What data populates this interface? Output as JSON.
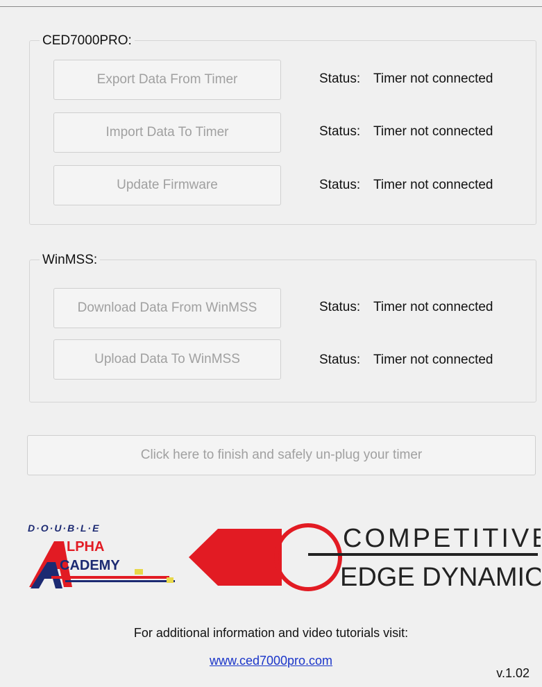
{
  "ced_group": {
    "title": "CED7000PRO:",
    "rows": [
      {
        "button": "Export Data From Timer",
        "status_label": "Status:",
        "status": "Timer not connected"
      },
      {
        "button": "Import Data To Timer",
        "status_label": "Status:",
        "status": "Timer not connected"
      },
      {
        "button": "Update Firmware",
        "status_label": "Status:",
        "status": "Timer not connected"
      }
    ]
  },
  "winmss_group": {
    "title": "WinMSS:",
    "rows": [
      {
        "button": "Download Data From WinMSS",
        "status_label": "Status:",
        "status": "Timer not connected"
      },
      {
        "button": "Upload Data To WinMSS",
        "status_label": "Status:",
        "status": "Timer not connected"
      }
    ]
  },
  "finish_button": "Click here to finish and safely un-plug your timer",
  "logos": {
    "daa": {
      "line1": "D·O·U·B·L·E",
      "line2": "LPHA",
      "line3": "CADEMY"
    },
    "ced": {
      "line1": "COMPETITIVE",
      "line2": "EDGE DYNAMICS"
    }
  },
  "footer": {
    "info": "For additional information and video tutorials visit:",
    "link": "www.ced7000pro.com",
    "version": "v.1.02"
  },
  "colors": {
    "logo_red": "#e21b23",
    "logo_navy": "#1c2a72",
    "link": "#1a35c9",
    "disabled_text": "#a0a0a0"
  }
}
